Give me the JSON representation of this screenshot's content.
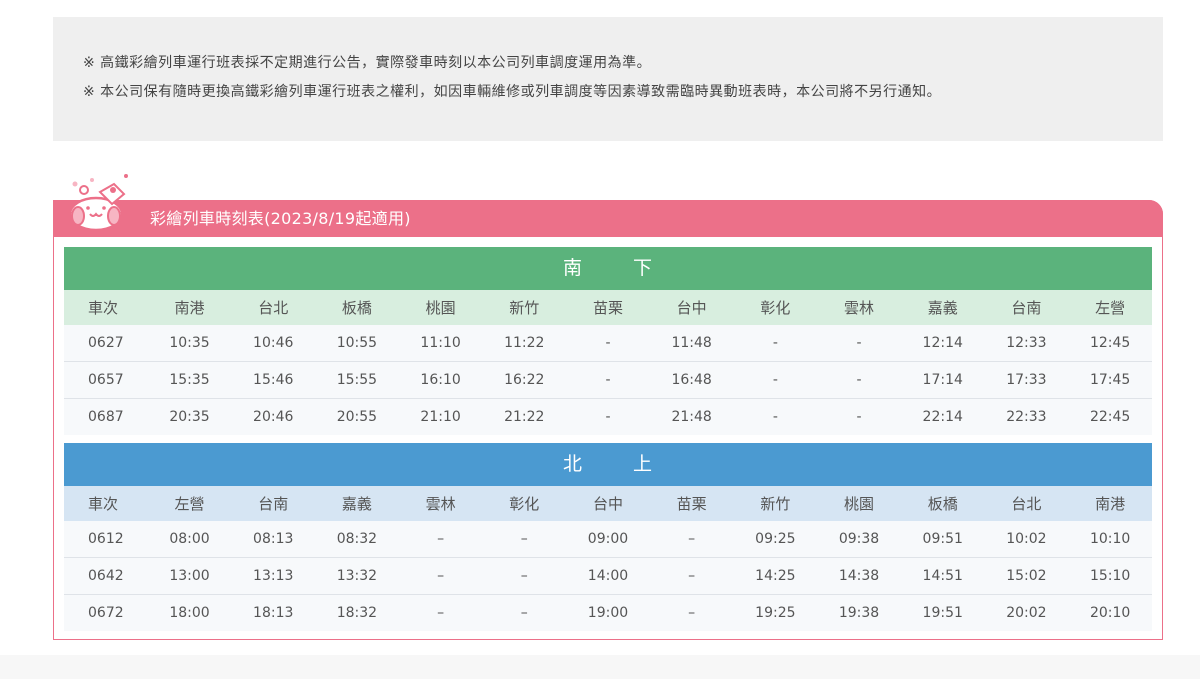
{
  "notice": {
    "line1": "※ 高鐵彩繪列車運行班表採不定期進行公告，實際發車時刻以本公司列車調度運用為準。",
    "line2": "※ 本公司保有隨時更換高鐵彩繪列車運行班表之權利，如因車輛維修或列車調度等因素導致需臨時異動班表時，本公司將不另行通知。"
  },
  "timetable": {
    "title": "彩繪列車時刻表(2023/8/19起適用)",
    "colors": {
      "header": "#ec7089",
      "south": "#5bb37c",
      "north": "#4b9ad1"
    },
    "south": {
      "dir_a": "南",
      "dir_b": "下",
      "columns": [
        "車次",
        "南港",
        "台北",
        "板橋",
        "桃園",
        "新竹",
        "苗栗",
        "台中",
        "彰化",
        "雲林",
        "嘉義",
        "台南",
        "左營"
      ],
      "rows": [
        [
          "0627",
          "10:35",
          "10:46",
          "10:55",
          "11:10",
          "11:22",
          "-",
          "11:48",
          "-",
          "-",
          "12:14",
          "12:33",
          "12:45"
        ],
        [
          "0657",
          "15:35",
          "15:46",
          "15:55",
          "16:10",
          "16:22",
          "-",
          "16:48",
          "-",
          "-",
          "17:14",
          "17:33",
          "17:45"
        ],
        [
          "0687",
          "20:35",
          "20:46",
          "20:55",
          "21:10",
          "21:22",
          "-",
          "21:48",
          "-",
          "-",
          "22:14",
          "22:33",
          "22:45"
        ]
      ]
    },
    "north": {
      "dir_a": "北",
      "dir_b": "上",
      "columns": [
        "車次",
        "左營",
        "台南",
        "嘉義",
        "雲林",
        "彰化",
        "台中",
        "苗栗",
        "新竹",
        "桃園",
        "板橋",
        "台北",
        "南港"
      ],
      "rows": [
        [
          "0612",
          "08:00",
          "08:13",
          "08:32",
          "–",
          "–",
          "09:00",
          "–",
          "09:25",
          "09:38",
          "09:51",
          "10:02",
          "10:10"
        ],
        [
          "0642",
          "13:00",
          "13:13",
          "13:32",
          "–",
          "–",
          "14:00",
          "–",
          "14:25",
          "14:38",
          "14:51",
          "15:02",
          "15:10"
        ],
        [
          "0672",
          "18:00",
          "18:13",
          "18:32",
          "–",
          "–",
          "19:00",
          "–",
          "19:25",
          "19:38",
          "19:51",
          "20:02",
          "20:10"
        ]
      ]
    }
  }
}
